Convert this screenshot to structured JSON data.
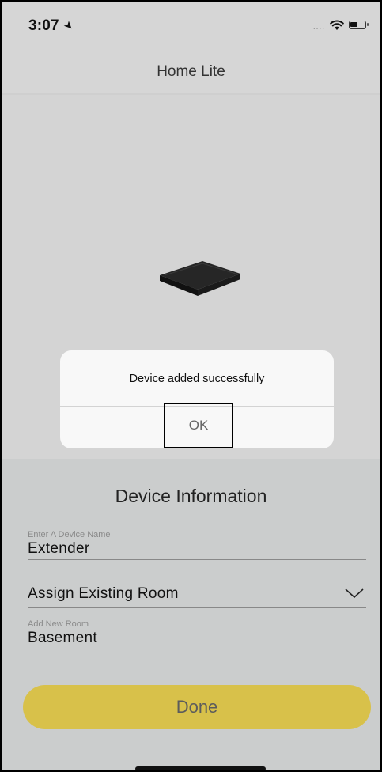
{
  "status_bar": {
    "time": "3:07",
    "location_icon": "location-arrow-icon",
    "signal_dots": "....",
    "wifi_icon": "wifi-icon",
    "battery_icon": "battery-icon"
  },
  "header": {
    "title": "Home Lite"
  },
  "device_image": {
    "icon": "extender-device-icon"
  },
  "alert": {
    "message": "Device added successfully",
    "ok_label": "OK"
  },
  "device_info": {
    "title": "Device Information",
    "name_field": {
      "label": "Enter A Device Name",
      "value": "Extender"
    },
    "room_select": {
      "label": "Assign Existing Room",
      "icon": "chevron-down-icon"
    },
    "new_room_field": {
      "label": "Add New Room",
      "value": "Basement"
    },
    "done_label": "Done"
  },
  "colors": {
    "done_button": "#d8c14a",
    "background": "#d5d5d5",
    "info_background": "#cbcdcd",
    "alert_background": "#f8f8f8"
  }
}
